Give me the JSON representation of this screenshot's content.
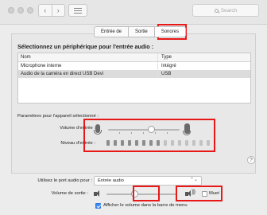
{
  "window": {
    "search_placeholder": "Search"
  },
  "tabs": [
    {
      "label": "Entrée de"
    },
    {
      "label": "Sortie"
    },
    {
      "label": "Sonores"
    }
  ],
  "heading": "Sélectionnez un périphérique pour l'entrée audio :",
  "table": {
    "columns": [
      "Nom",
      "Type"
    ],
    "rows": [
      {
        "name": "Microphone interne",
        "type": "Intégré"
      },
      {
        "name": "Audio de la caméra en direct USB Devi",
        "type": "USB"
      }
    ],
    "selected_row": "Audio de la caméra en direct USB Devi"
  },
  "settings": {
    "section_label": "Paramètres pour l'appareil sélectionné :",
    "input_volume_label": "Volume d'entrée :",
    "input_level_label": "Niveau d'entrée :",
    "input_volume_fraction": 0.6,
    "input_level_bars_total": 15,
    "input_level_bars_lit": 8
  },
  "bottom": {
    "port_label": "Utilisez le port audio pour :",
    "port_value": "Entrée audio",
    "output_volume_label": "Volume de sortie :",
    "output_volume_fraction": 0.4,
    "mute_label": "Muet",
    "mute_checked": false,
    "show_in_menu_label": "Afficher le volume dans la barre de menu",
    "show_in_menu_checked": true
  },
  "icons": {
    "help": "?",
    "back": "‹",
    "forward": "›",
    "select_arrows": "⌃⌄"
  },
  "colors": {
    "highlight": "#e81818",
    "checkbox_on": "#3b88f0"
  }
}
